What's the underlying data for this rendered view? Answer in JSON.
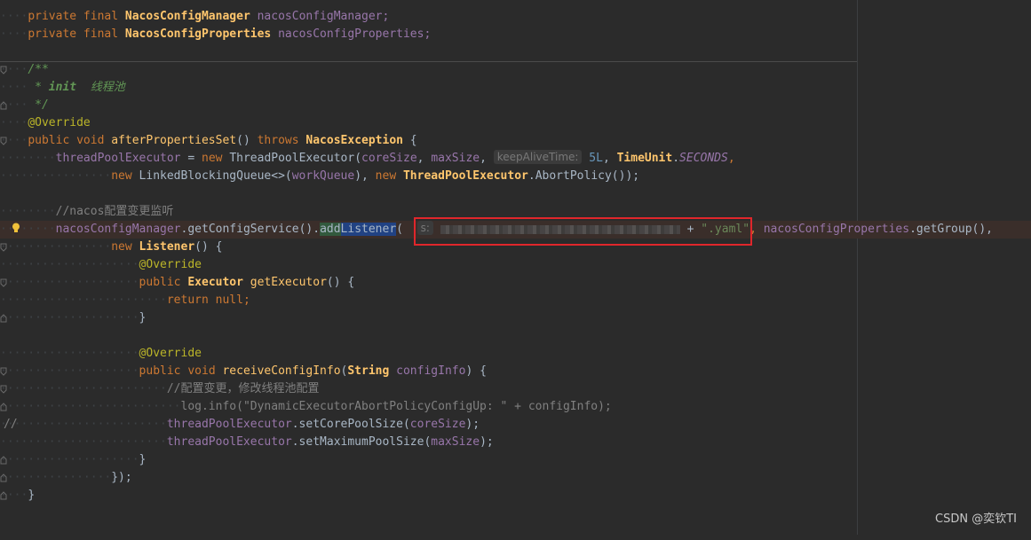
{
  "editor": {
    "lines": {
      "l1": {
        "kw": "private final ",
        "type": "NacosConfigManager",
        "name": " nacosConfigManager;"
      },
      "l2": {
        "kw": "private final ",
        "type": "NacosConfigProperties",
        "name": " nacosConfigProperties;"
      },
      "l3": {
        "text": "/**"
      },
      "l4": {
        "star": " * ",
        "tag": "init",
        "text": "  线程池"
      },
      "l5": {
        "text": " */"
      },
      "l6": {
        "text": "@Override"
      },
      "l7": {
        "kw1": "public void ",
        "method": "afterPropertiesSet",
        "paren": "() ",
        "kw2": "throws ",
        "exc": "NacosException",
        "brace": " {"
      },
      "l8": {
        "field": "threadPoolExecutor",
        "eq": " = ",
        "kw": "new ",
        "cls": "ThreadPoolExecutor(",
        "a1": "coreSize",
        ", ": ", ",
        "a2": "maxSize",
        "comma": ", ",
        "hint": "keepAliveTime:",
        "num": "5L",
        ",": ", ",
        "tu": "TimeUnit",
        "dot": ".",
        "sec": "SECONDS",
        ",2": ","
      },
      "l9": {
        "kw": "new ",
        "cls": "LinkedBlockingQueue<>(",
        "arg": "workQueue",
        "mid": "), ",
        "kw2": "new ",
        "cls2": "ThreadPoolExecutor",
        "tail": ".AbortPolicy());"
      },
      "l11": {
        "text": "//nacos配置变更监听"
      },
      "l12": {
        "field": "nacosConfigManager",
        "m1": ".getConfigService().",
        "usage": "add",
        "sel": "Listener",
        "paren": "(",
        "hint": "s:",
        "blurred": "...ication\"...",
        "plus": " + ",
        "str": "\".yaml\"",
        ",": ", ",
        "field2": "nacosConfigProperties",
        "tail": ".getGroup(),"
      },
      "l13": {
        "kw": "new ",
        "cls": "Listener",
        "tail": "() {"
      },
      "l14": {
        "text": "@Override"
      },
      "l15": {
        "kw": "public ",
        "cls": "Executor ",
        "method": "getExecutor",
        "tail": "() {"
      },
      "l16": {
        "kw": "return null",
        "semi": ";"
      },
      "l17": {
        "text": "}"
      },
      "l19": {
        "text": "@Override"
      },
      "l20": {
        "kw": "public void ",
        "method": "receiveConfigInfo",
        "p1": "(",
        "cls": "String ",
        "arg": "configInfo",
        "tail": ") {"
      },
      "l21": {
        "text": "//配置变更，修改线程池配置"
      },
      "l22": {
        "mark": "//",
        "text": "log.info(\"DynamicExecutorAbortPolicyConfigUp: \" + configInfo);"
      },
      "l23": {
        "field": "threadPoolExecutor",
        "mid": ".setCorePoolSize(",
        "arg": "coreSize",
        "tail": ");"
      },
      "l24": {
        "field": "threadPoolExecutor",
        "mid": ".setMaximumPoolSize(",
        "arg": "maxSize",
        "tail": ");"
      },
      "l25": {
        "text": "}"
      },
      "l26": {
        "text": "});"
      },
      "l27": {
        "text": "}"
      }
    }
  },
  "watermark": "CSDN @奕钦TI",
  "colors": {
    "highlight_box": "#e0262b",
    "background": "#2b2b2b"
  }
}
